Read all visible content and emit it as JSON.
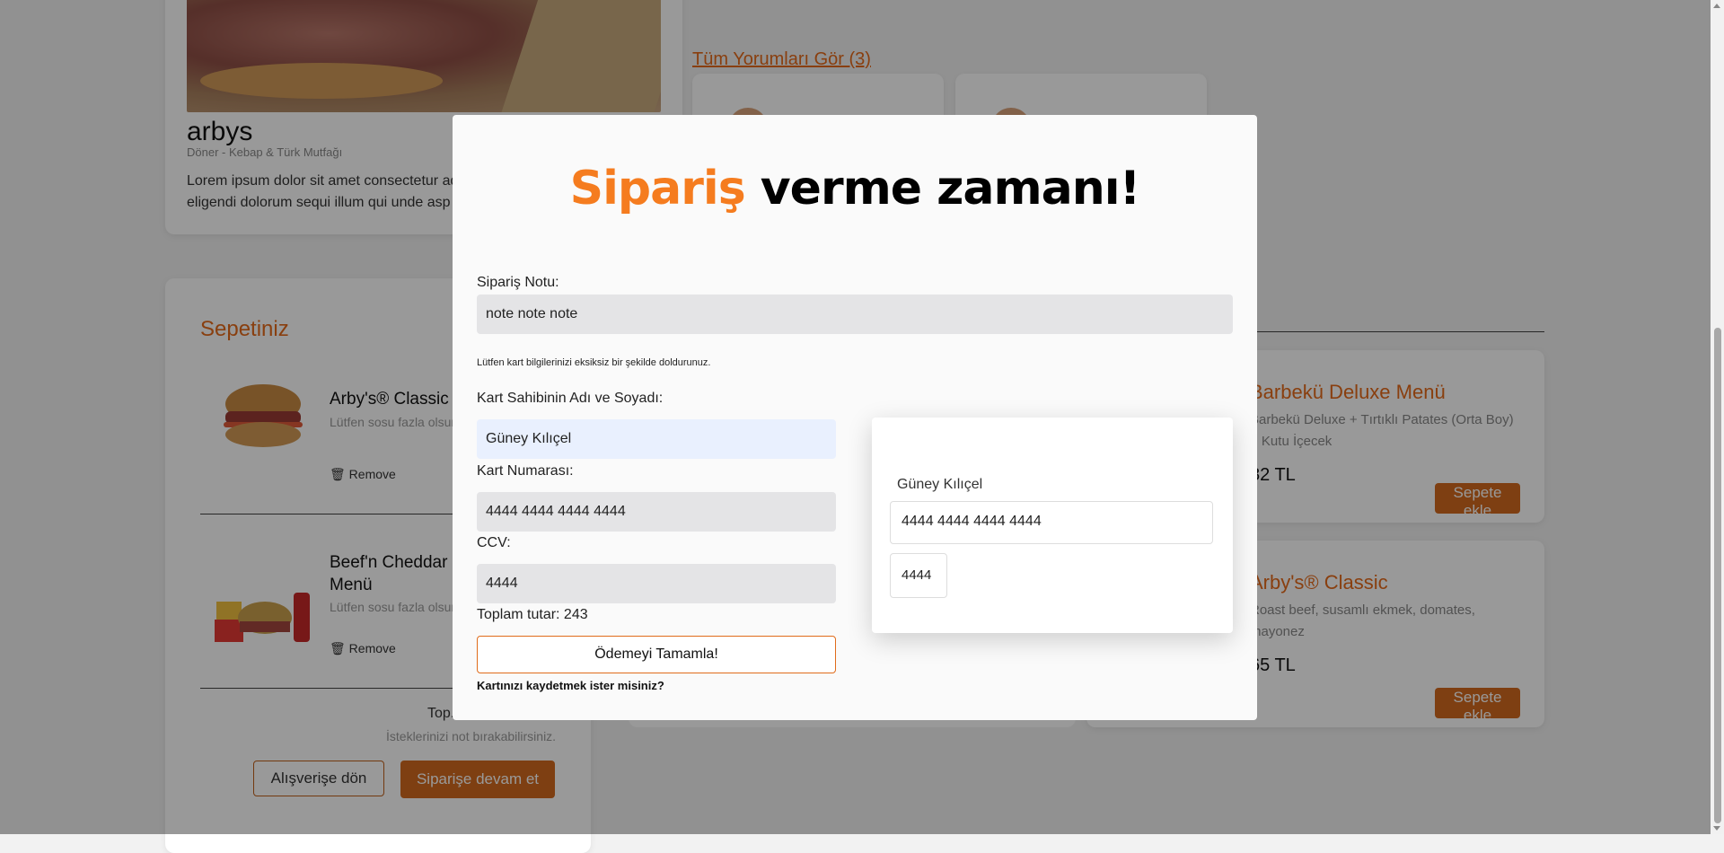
{
  "restaurant": {
    "name": "arbys",
    "category": "Döner - Kebap & Türk Mutfağı",
    "description": "Lorem ipsum dolor sit amet consectetur ad eligendi dolorum sequi illum qui unde asp"
  },
  "reviews": {
    "link": "Tüm Yorumları Gör (3)"
  },
  "cart": {
    "title": "Sepetiniz",
    "items": [
      {
        "name": "Arby's® Classic",
        "note": "Lütfen sosu fazla olsun",
        "remove": "Remove"
      },
      {
        "name": "Beef'n Cheddar Menü",
        "note": "Lütfen sosu fazla olsun",
        "remove": "Remove"
      }
    ],
    "total_label": "Top.",
    "hint": "İsteklerinizi not bırakabilirsiniz.",
    "back_button": "Alışverişe dön",
    "continue_button": "Siparişe devam et"
  },
  "menu": {
    "items": [
      {
        "name": "Barbekü Deluxe Menü",
        "description": "Barbekü Deluxe + Tırtıklı Patates (Orta Boy) + Kutu İçecek",
        "price": "82 TL",
        "add": "Sepete ekle"
      },
      {
        "name": "Arby's® Classic",
        "description": "Roast beef, susamlı ekmek, domates, mayonez",
        "price": "65 TL",
        "add": "Sepete ekle"
      }
    ]
  },
  "modal": {
    "title_accent": "Sipariş",
    "title_rest": " verme zamanı!",
    "note_label": "Sipariş Notu:",
    "note_value": "note note note",
    "card_hint": "Lütfen kart bilgilerinizi eksiksiz bir şekilde doldurunuz.",
    "holder_label": "Kart Sahibinin Adı ve Soyadı:",
    "holder_value": "Güney Kılıçel",
    "number_label": "Kart Numarası:",
    "number_value": "4444 4444 4444 4444",
    "ccv_label": "CCV:",
    "ccv_value": "4444",
    "total": "Toplam tutar: 243",
    "pay_button": "Ödemeyi Tamamla!",
    "save_question": "Kartınızı kaydetmek ister misiniz?",
    "preview": {
      "name": "Güney Kılıçel",
      "number": "4444 4444 4444 4444",
      "ccv": "4444"
    }
  },
  "colors": {
    "accent": "#f57c1f",
    "button": "#d2691e",
    "overlay": "rgba(0,0,0,0.4)"
  }
}
